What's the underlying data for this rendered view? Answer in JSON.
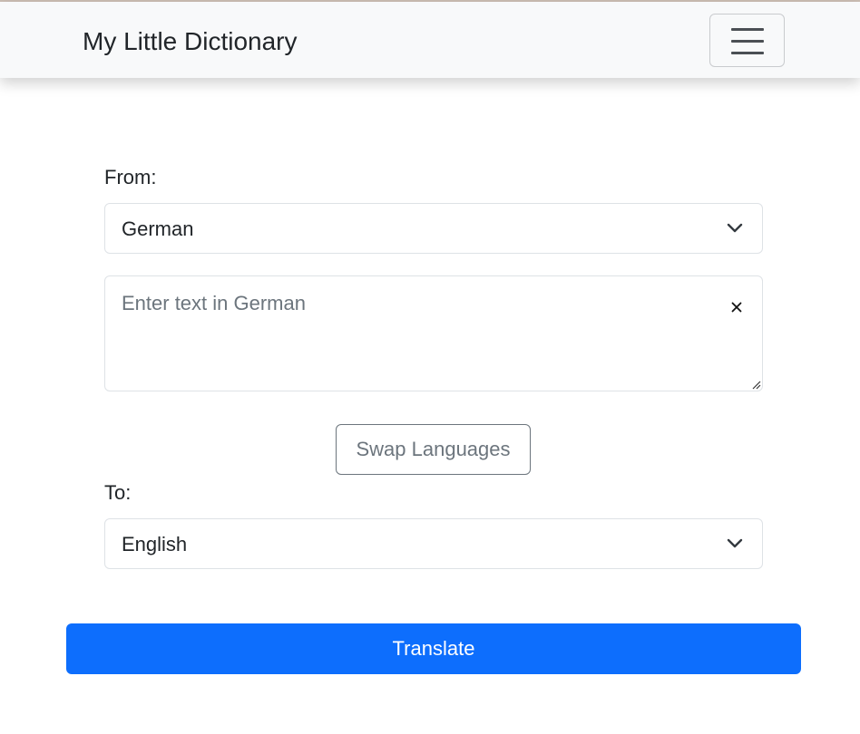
{
  "navbar": {
    "brand": "My Little Dictionary",
    "menu_icon": "hamburger-menu-icon"
  },
  "form": {
    "from_label": "From:",
    "from_selected": "German",
    "input_placeholder": "Enter text in German",
    "input_value": "",
    "clear_icon": "close-icon",
    "swap_label": "Swap Languages",
    "to_label": "To:",
    "to_selected": "English",
    "translate_label": "Translate"
  },
  "colors": {
    "navbar_bg": "#f8f9fa",
    "primary": "#0d6efd",
    "secondary": "#6c757d"
  }
}
